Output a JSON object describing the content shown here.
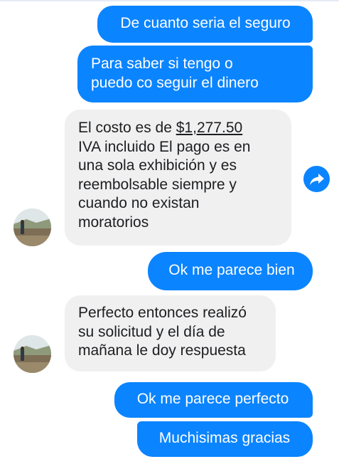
{
  "messages": {
    "m1": "De cuanto seria el seguro",
    "m2_line1": "Para saber si tengo o",
    "m2_line2": "puedo co seguir el dinero",
    "m3_prefix": "El costo es de ",
    "m3_price": "$1,277.50",
    "m3_line2": "IVA incluido El pago es en",
    "m3_line3": "una sola exhibición y es",
    "m3_line4": "reembolsable siempre y",
    "m3_line5": "cuando no existan",
    "m3_line6": "moratorios",
    "m4": "Ok me parece bien",
    "m5_line1": "Perfecto entonces realizó",
    "m5_line2": "su solicitud y el día de",
    "m5_line3": "mañana le doy respuesta",
    "m6": "Ok me parece perfecto",
    "m7": "Muchisimas gracias"
  },
  "icons": {
    "share": "share-arrow-icon",
    "avatar": "contact-avatar"
  },
  "colors": {
    "outgoing_bubble": "#0b84ff",
    "incoming_bubble": "#f1f0f0",
    "incoming_text": "#1c1e21"
  }
}
